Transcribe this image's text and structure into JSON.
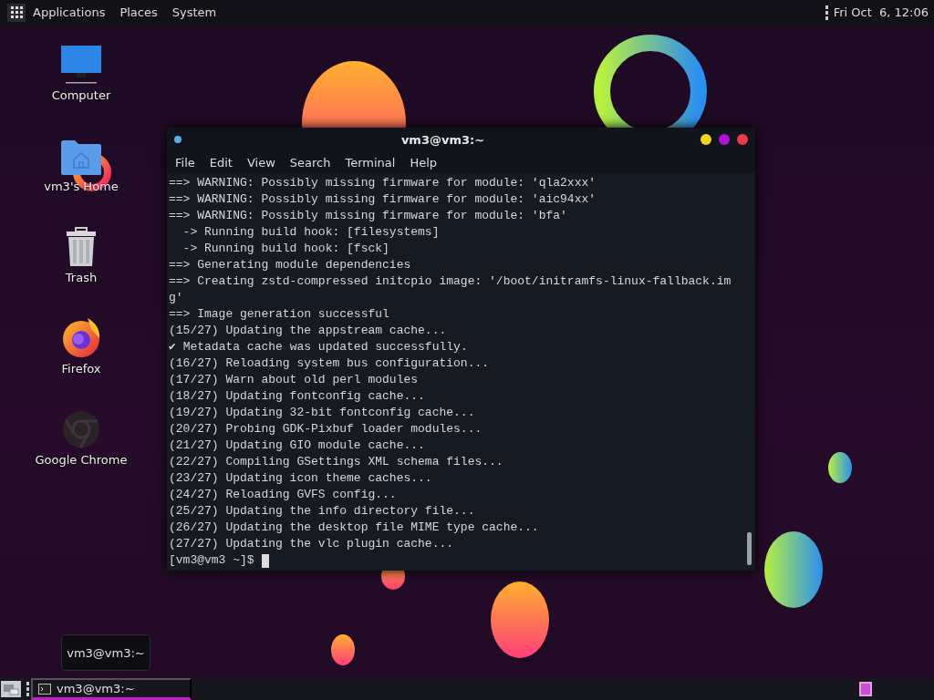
{
  "top_panel": {
    "menus": [
      "Applications",
      "Places",
      "System"
    ],
    "clock": "Fri Oct  6, 12:06"
  },
  "desktop_icons": [
    {
      "label": "Computer",
      "kind": "computer"
    },
    {
      "label": "vm3's Home",
      "kind": "home"
    },
    {
      "label": "Trash",
      "kind": "trash"
    },
    {
      "label": "Firefox",
      "kind": "firefox"
    },
    {
      "label": "Google Chrome",
      "kind": "chrome"
    }
  ],
  "terminal": {
    "title": "vm3@vm3:~",
    "menu": [
      "File",
      "Edit",
      "View",
      "Search",
      "Terminal",
      "Help"
    ],
    "lines": [
      "==> WARNING: Possibly missing firmware for module: 'qla2xxx'",
      "==> WARNING: Possibly missing firmware for module: 'aic94xx'",
      "==> WARNING: Possibly missing firmware for module: 'bfa'",
      "  -> Running build hook: [filesystems]",
      "  -> Running build hook: [fsck]",
      "==> Generating module dependencies",
      "==> Creating zstd-compressed initcpio image: '/boot/initramfs-linux-fallback.im",
      "g'",
      "==> Image generation successful",
      "(15/27) Updating the appstream cache...",
      "✔ Metadata cache was updated successfully.",
      "(16/27) Reloading system bus configuration...",
      "(17/27) Warn about old perl modules",
      "(18/27) Updating fontconfig cache...",
      "(19/27) Updating 32-bit fontconfig cache...",
      "(20/27) Probing GDK-Pixbuf loader modules...",
      "(21/27) Updating GIO module cache...",
      "(22/27) Compiling GSettings XML schema files...",
      "(23/27) Updating icon theme caches...",
      "(24/27) Reloading GVFS config...",
      "(25/27) Updating the info directory file...",
      "(26/27) Updating the desktop file MIME type cache...",
      "(27/27) Updating the vlc plugin cache..."
    ],
    "prompt": "[vm3@vm3 ~]$"
  },
  "tooltip": "vm3@vm3:~",
  "taskbar": {
    "tasks": [
      {
        "label": "vm3@vm3:~",
        "selected": true
      }
    ],
    "workspaces": [
      {
        "selected": true
      }
    ]
  }
}
